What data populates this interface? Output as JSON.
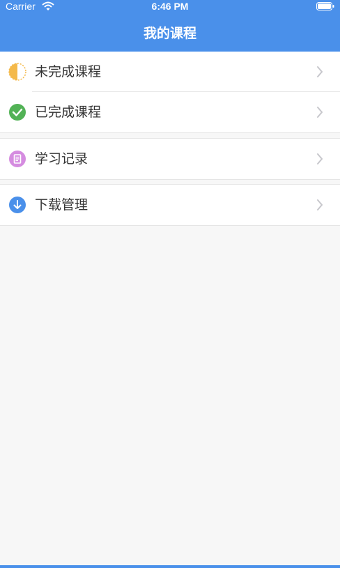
{
  "status_bar": {
    "carrier": "Carrier",
    "time": "6:46 PM",
    "wifi_icon": "wifi-icon",
    "battery_icon": "battery-icon"
  },
  "nav": {
    "title": "我的课程"
  },
  "menu": {
    "items": [
      {
        "label": "未完成课程",
        "icon": "half-moon-icon",
        "icon_color": "#f4b94a"
      },
      {
        "label": "已完成课程",
        "icon": "checkmark-circle-icon",
        "icon_color": "#52b256"
      },
      {
        "label": "学习记录",
        "icon": "document-icon",
        "icon_color": "#d58ce0"
      },
      {
        "label": "下载管理",
        "icon": "download-arrow-icon",
        "icon_color": "#4a90ea"
      }
    ],
    "chevron_icon": "chevron-right-icon"
  },
  "colors": {
    "header": "#4a90ea",
    "background": "#f7f7f7",
    "row": "#ffffff",
    "text": "#333333",
    "chevron": "#c7c7cc"
  }
}
